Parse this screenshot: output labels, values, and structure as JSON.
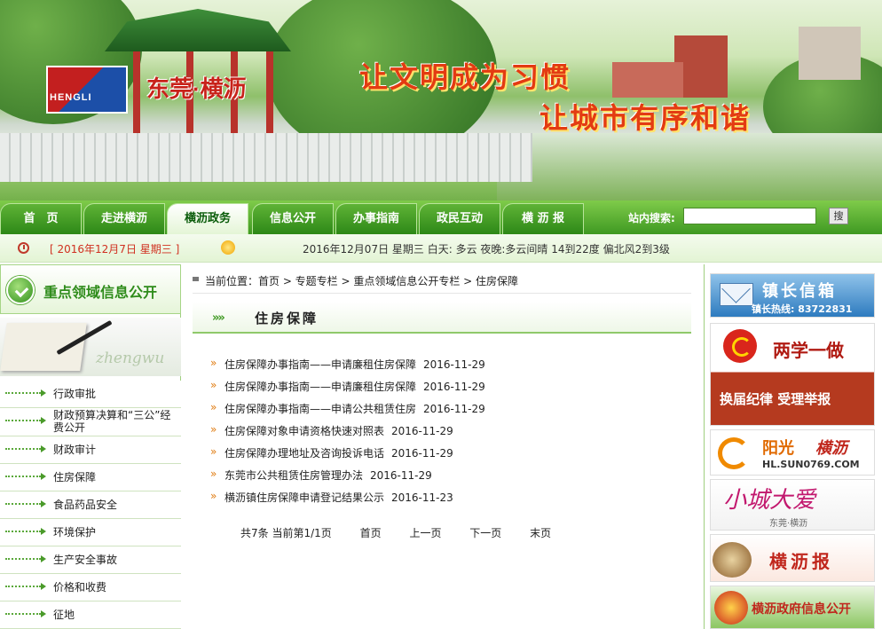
{
  "banner": {
    "logo_text": "HENGLI",
    "place_name": "东莞·横沥",
    "slogan_line1": "让文明成为习惯",
    "slogan_line2": "让城市有序和谐"
  },
  "nav": {
    "tabs": [
      {
        "label": "首　页"
      },
      {
        "label": "走进横沥"
      },
      {
        "label": "横沥政务"
      },
      {
        "label": "信息公开"
      },
      {
        "label": "办事指南"
      },
      {
        "label": "政民互动"
      },
      {
        "label": "横 沥 报"
      }
    ],
    "active_tab": "横沥政务",
    "search_label": "站内搜索:",
    "search_value": "",
    "search_button": "搜"
  },
  "infobar": {
    "date": "[ 2016年12月7日 星期三 ]",
    "weather": "2016年12月07日 星期三 白天: 多云 夜晚:多云间晴 14到22度 偏北风2到3级"
  },
  "sidebar": {
    "title": "重点领域信息公开",
    "decor_text": "zhengwu",
    "items": [
      {
        "label": "行政审批"
      },
      {
        "label": "财政预算决算和“三公”经费公开"
      },
      {
        "label": "财政审计"
      },
      {
        "label": "住房保障"
      },
      {
        "label": "食品药品安全"
      },
      {
        "label": "环境保护"
      },
      {
        "label": "生产安全事故"
      },
      {
        "label": "价格和收费"
      },
      {
        "label": "征地"
      }
    ]
  },
  "main": {
    "breadcrumb": "当前位置：首页 > 专题专栏 > 重点领域信息公开专栏 > 住房保障",
    "title": "住房保障",
    "title_chevrons": "»»",
    "articles": [
      {
        "title": "住房保障办事指南——申请廉租住房保障",
        "date": "2016-11-29"
      },
      {
        "title": "住房保障办事指南——申请廉租住房保障",
        "date": "2016-11-29"
      },
      {
        "title": "住房保障办事指南——申请公共租赁住房",
        "date": "2016-11-29"
      },
      {
        "title": "住房保障对象申请资格快速对照表",
        "date": "2016-11-29"
      },
      {
        "title": "住房保障办理地址及咨询投诉电话",
        "date": "2016-11-29"
      },
      {
        "title": "东莞市公共租赁住房管理办法",
        "date": "2016-11-29"
      },
      {
        "title": "横沥镇住房保障申请登记结果公示",
        "date": "2016-11-23"
      }
    ],
    "bullet": "»",
    "pager": {
      "summary": "共7条  当前第1/1页",
      "first": "首页",
      "prev": "上一页",
      "next": "下一页",
      "last": "末页"
    }
  },
  "right": {
    "mayor_box_title": "镇长信箱",
    "mayor_hotline": "镇长热线: 83722831",
    "two_studies_title": "两学一做",
    "two_studies_sub": "换届纪律  受理举报",
    "sunshine_title": "阳光",
    "sunshine_title2": "横沥",
    "sunshine_url": "HL.SUN0769.COM",
    "small_city_title": "小城大爱",
    "small_city_sub": "东莞·横沥",
    "newspaper_title": "横沥报",
    "gov_info_title": "横沥政府信息公开"
  },
  "colors": {
    "nav_green": "#3f9922",
    "accent_red": "#d03020",
    "bullet_orange": "#e07b10"
  }
}
